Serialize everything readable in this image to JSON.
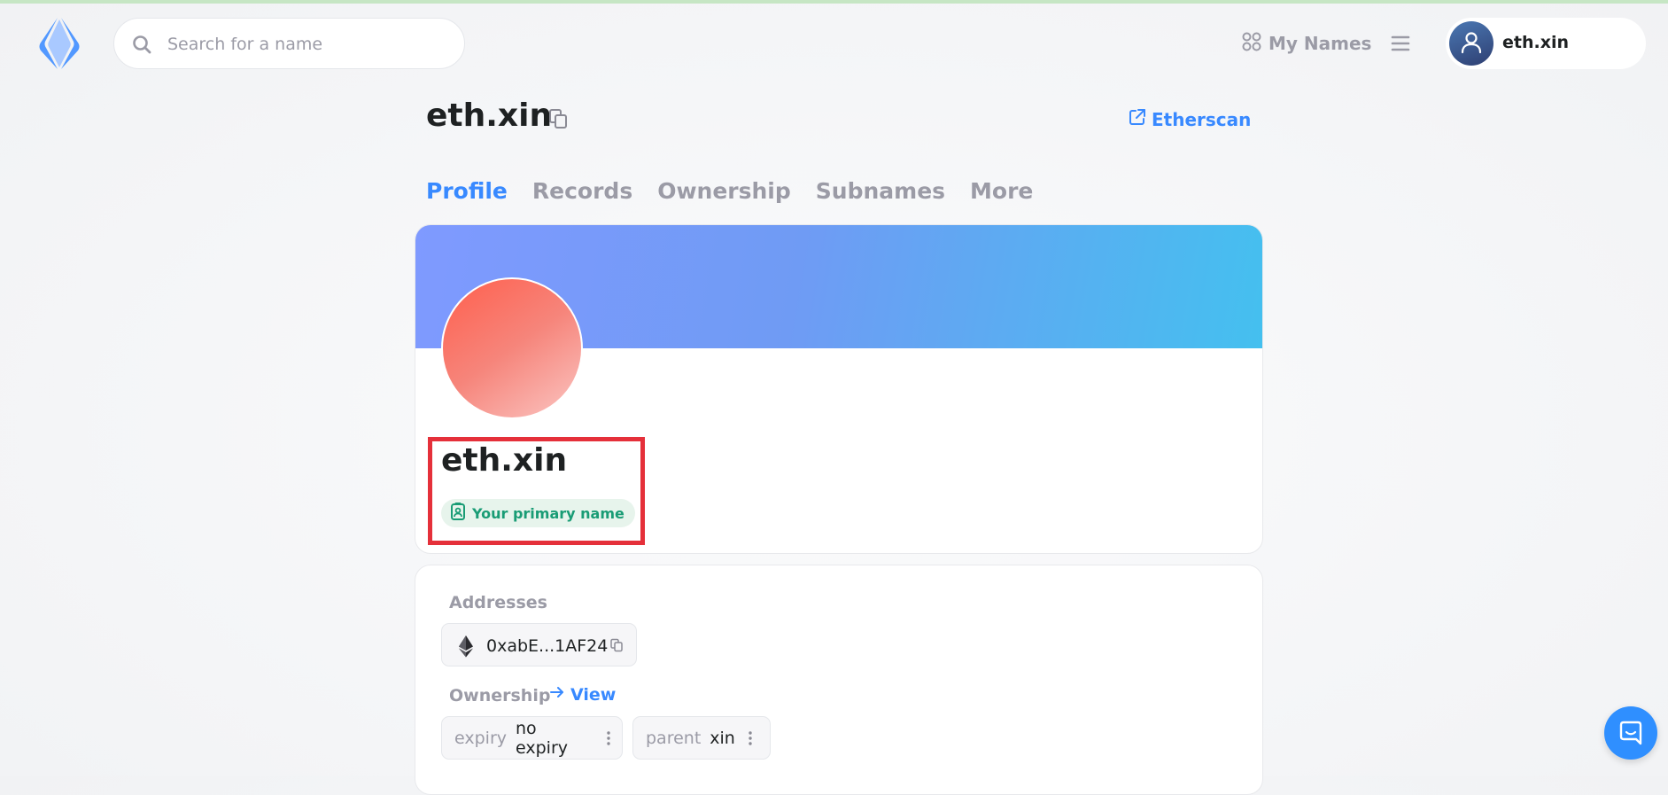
{
  "header": {
    "search": {
      "placeholder": "Search for a name",
      "value": ""
    },
    "my_names_label": "My Names",
    "account_name": "eth.xin"
  },
  "page": {
    "title": "eth.xin",
    "etherscan_label": "Etherscan"
  },
  "tabs": [
    {
      "label": "Profile",
      "active": true
    },
    {
      "label": "Records",
      "active": false
    },
    {
      "label": "Ownership",
      "active": false
    },
    {
      "label": "Subnames",
      "active": false
    },
    {
      "label": "More",
      "active": false
    }
  ],
  "profile": {
    "name": "eth.xin",
    "primary_badge": "Your primary name"
  },
  "details": {
    "addresses_label": "Addresses",
    "address_value": "0xabE...1AF24",
    "ownership_label": "Ownership",
    "view_label": "View",
    "chips": [
      {
        "key": "expiry",
        "value": "no expiry"
      },
      {
        "key": "parent",
        "value": "xin"
      }
    ]
  },
  "colors": {
    "accent": "#3889ff",
    "primary_badge_text": "#199c75",
    "primary_badge_bg": "#e7f4ec",
    "highlight_border": "#e5303a",
    "muted_text": "#9b9ba6"
  }
}
